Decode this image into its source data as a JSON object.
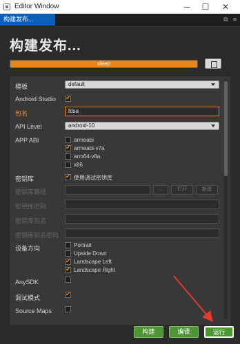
{
  "window": {
    "title": "Editor Window",
    "min_glyph": "─",
    "max_glyph": "☐",
    "close_glyph": "✕"
  },
  "tab": {
    "label": "构建发布..."
  },
  "page": {
    "title": "构建发布..."
  },
  "progress": {
    "label": "sleep",
    "fraction": 1.0
  },
  "fields": {
    "template": {
      "label": "模板",
      "value": "default"
    },
    "android_studio": {
      "label": "Android Studio",
      "checked": true
    },
    "package_name": {
      "label": "包名",
      "value": "fdsa"
    },
    "api_level": {
      "label": "API Level",
      "value": "android-10"
    },
    "app_abi": {
      "label": "APP ABI",
      "options": [
        {
          "label": "armeabi",
          "checked": false
        },
        {
          "label": "armeabi-v7a",
          "checked": true
        },
        {
          "label": "arm64-v8a",
          "checked": false
        },
        {
          "label": "x86",
          "checked": false
        }
      ]
    },
    "keystore": {
      "label": "密钥库",
      "checkbox_label": "使用调试密钥库",
      "checked": true
    },
    "keystore_path": {
      "label": "密钥库路径",
      "value": "",
      "ellipsis": "...",
      "open": "打开",
      "new": "新建"
    },
    "keystore_password": {
      "label": "密钥库密码",
      "value": ""
    },
    "keystore_alias": {
      "label": "密钥库别名",
      "value": ""
    },
    "keystore_alias_password": {
      "label": "密钥库别名密码",
      "value": ""
    },
    "orientation": {
      "label": "设备方向",
      "options": [
        {
          "label": "Portrait",
          "checked": false
        },
        {
          "label": "Upside Down",
          "checked": false
        },
        {
          "label": "Landscape Left",
          "checked": true
        },
        {
          "label": "Landscape Right",
          "checked": true
        }
      ]
    },
    "anysdk": {
      "label": "AnySDK",
      "checked": false
    },
    "debug_mode": {
      "label": "调试模式",
      "checked": true
    },
    "source_maps": {
      "label": "Source Maps",
      "checked": false
    }
  },
  "footer": {
    "build": "构建",
    "compile": "编译",
    "run": "运行"
  },
  "colors": {
    "accent": "#e98617",
    "button_green": "#4e9634",
    "annotation_arrow": "#e53b2e"
  }
}
